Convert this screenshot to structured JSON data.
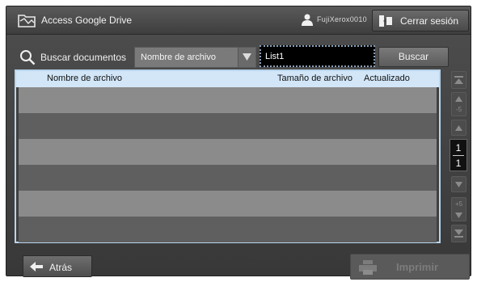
{
  "header": {
    "title": "Access Google Drive",
    "user_name": "FujiXerox0010",
    "logout_label": "Cerrar sesión",
    "app_icon": "folder-drive-icon",
    "user_icon": "user-icon",
    "logout_icon": "logout-icon"
  },
  "search": {
    "label": "Buscar documentos",
    "icon": "search-icon",
    "field_select": "Nombre de archivo",
    "input_value": "List1",
    "button_label": "Buscar"
  },
  "table": {
    "columns": [
      "Nombre de archivo",
      "Tamaño de archivo",
      "Actualizado"
    ],
    "rows": []
  },
  "pager": {
    "current": "1",
    "total": "1",
    "step_up": "-5",
    "step_down": "+5"
  },
  "footer": {
    "back_label": "Atrás",
    "print_label": "Imprimir"
  },
  "colors": {
    "header_row": "#d2e6f8",
    "table_border": "#b8d4ec",
    "row_light": "#8b8b8b",
    "row_dark": "#5f5f5f"
  }
}
